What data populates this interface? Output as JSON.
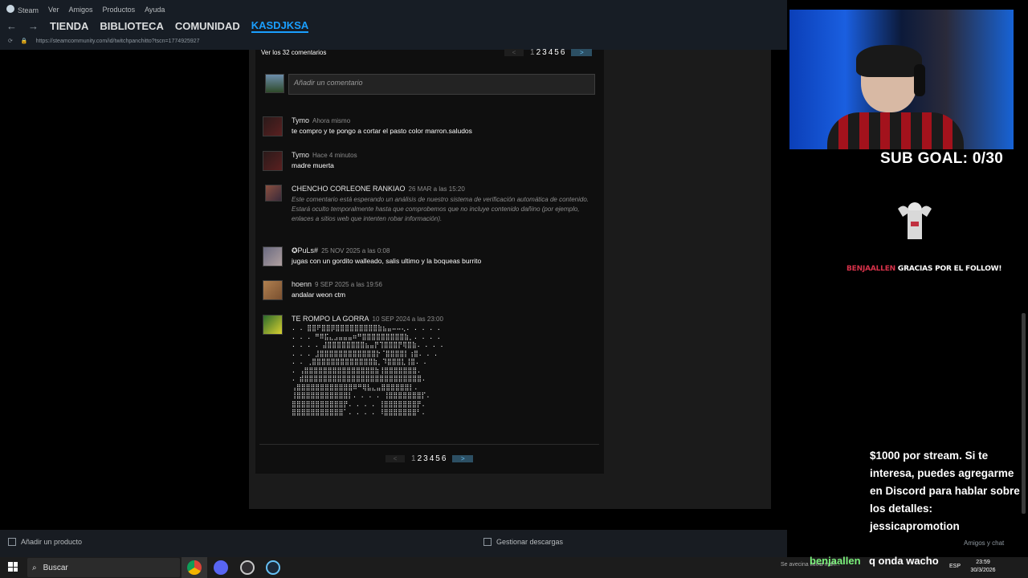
{
  "menu": {
    "app": "Steam",
    "items": [
      "Ver",
      "Amigos",
      "Productos",
      "Ayuda"
    ]
  },
  "nav": {
    "items": [
      "TIENDA",
      "BIBLIOTECA",
      "COMUNIDAD",
      "KASDJKSA"
    ]
  },
  "url": "https://steamcommunity.com/id/twitchpanchitto?tscn=1774925927",
  "comments_header": "Ver los 32 comentarios",
  "pager": {
    "prev": "<",
    "pages": [
      "1",
      "2",
      "3",
      "4",
      "5",
      "6"
    ],
    "next": ">"
  },
  "add_comment_placeholder": "Añadir un comentario",
  "comments": [
    {
      "name": "Tymo",
      "time": "Ahora mismo",
      "text": "te compro y te pongo a cortar el pasto color marron.saludos"
    },
    {
      "name": "Tymo",
      "time": "Hace 4 minutos",
      "text": "madre muerta"
    },
    {
      "name": "CHENCHO CORLEONE RANKIAO",
      "time": "26 MAR a las 15:20",
      "text": "Este comentario está esperando un análisis de nuestro sistema de verificación automática de contenido. Estará oculto temporalmente hasta que comprobemos que no incluye contenido dañino (por ejemplo, enlaces a sitios web que intenten robar información)."
    },
    {
      "name": "✪PuLs#",
      "time": "25 NOV 2025 a las 0:08",
      "text": "jugas con un gordito walleado, salis ultimo y la boqueas burrito"
    },
    {
      "name": "hoenn",
      "time": "9 SEP 2025 a las 19:56",
      "text": "andalar weon ctm"
    },
    {
      "name": "TE ROMPO LA GORRA",
      "time": "10 SEP 2024 a las 23:00",
      "text": ". . ⣿⣿⠟⣿⣿⡿⣿⣿⣿⣿⣿⣿⣿⣿⣿⣷⣦⣤⠤⠤⢄. . . . .\n. . . ⠛⠿⣯⣄⣠⣤⣤⣤⠶⠛⣿⣿⣿⣿⣿⣿⣿⣿⣿⣷⡀. . . .\n. . . . ⣼⣿⣿⣿⣿⣿⣿⣿⣿⣦⣤⡟⢹⣿⣿⣿⡟⢿⣿⣷. . . .\n. . . ⣸⣿⣿⣿⣿⣿⣿⣿⣿⣿⣿⣿⣿⡗⠈⣿⣿⣿⣿⡇⢰⣿. . .\n. . ⢀⣿⣿⣿⣿⣿⣿⣿⣿⣿⣿⣿⣿⣿⣷⡀⠹⣿⣿⣿⣇⢸⣿. .\n. ⢠⣿⣿⣿⣿⣿⣿⣿⣿⣿⣿⣿⣿⣿⣿⣿⣷⢸⣿⣿⣿⣿⣿⣿⣿.\n. ⣾⣿⣿⣿⣿⣿⣿⣿⣿⣿⣿⣿⣿⣿⣿⣿⣿⣿⣿⣿⣿⣿⣿⣿⣿⣿.\n⢠⣿⣿⣿⣿⣿⣿⣿⣿⣿⣿⣿⣿⠿⠛⢿⣧⣄⣤⣿⣿⣿⣿⣿⣿⡇.\n⢸⣿⣿⣿⣿⣿⣿⣿⣿⣿⣿⣿⡇. . . . ⢸⣿⣿⣿⣿⣿⣿⣿⡏.\n⣿⣿⣿⣿⣿⣿⣿⣿⣿⣿⣿⡟. . . . ⢸⣿⣿⣿⣿⣿⣿⣿⡟.\n⣿⣿⣿⣿⣿⣿⣿⣿⣿⣿⣿⠁. . . . ⠸⣿⣿⣿⣿⣿⣿⣿⠃."
    }
  ],
  "bottom": {
    "add_product": "Añadir un producto",
    "manage_downloads": "Gestionar descargas",
    "friends_chat": "Amigos y chat"
  },
  "taskbar": {
    "search": "Buscar",
    "lang": "ESP",
    "time": "23:59",
    "date": "30/3/2026",
    "news": "Se avecina lluvia mañ..."
  },
  "overlay": {
    "sub_goal": "SUB GOAL: 0/30",
    "follow_user": "BENJAALLEN",
    "follow_text": " GRACIAS POR EL FOLLOW!",
    "chat_message": "$1000 por stream. Si te interesa, puedes agregarme en Discord para hablar sobre los detalles: jessicapromotion",
    "chat_user": "benjaallen",
    "chat_user_message": "q onda wacho"
  },
  "colors": {
    "steam_blue": "#1a9fff",
    "follow_red": "#d8324a",
    "chat_green": "#7cf27c"
  }
}
